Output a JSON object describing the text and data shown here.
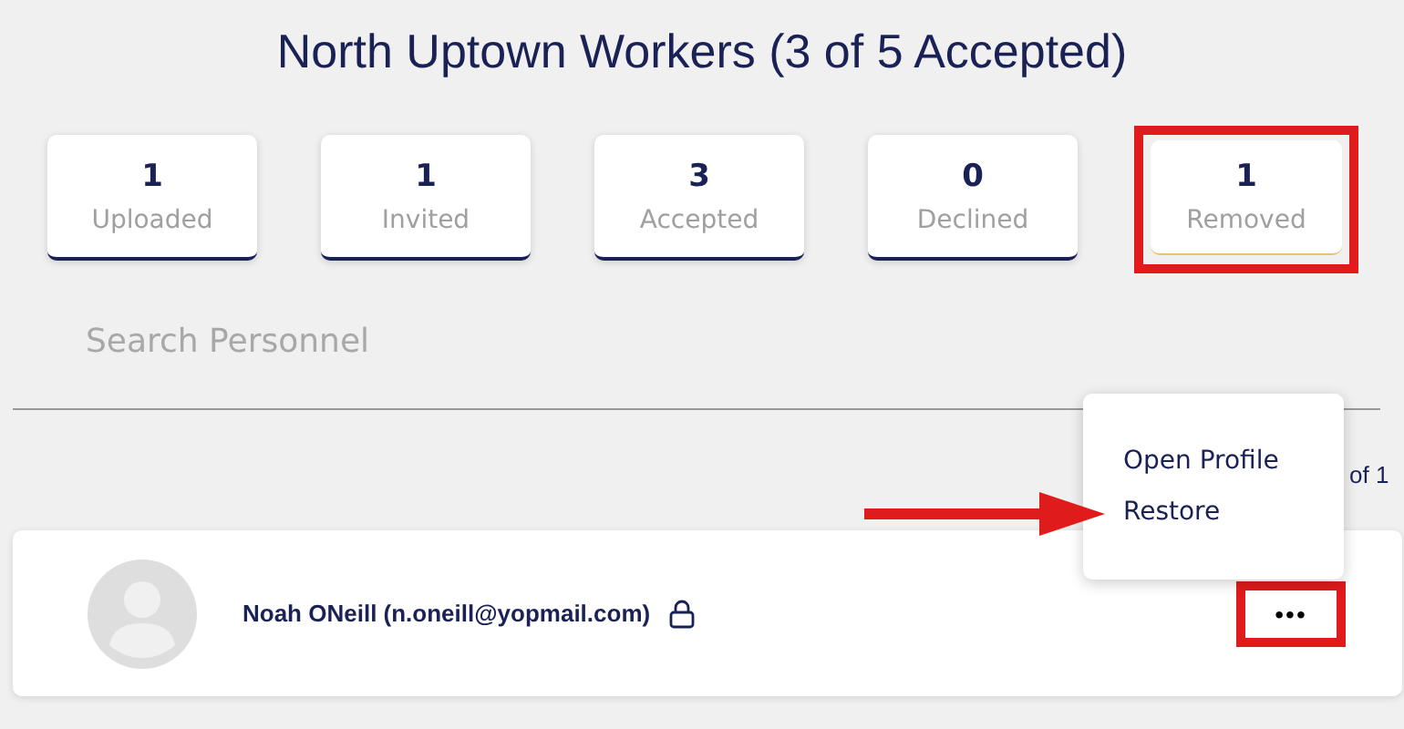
{
  "title": "North Uptown Workers (3 of 5 Accepted)",
  "stats": [
    {
      "count": "1",
      "label": "Uploaded",
      "highlighted": false
    },
    {
      "count": "1",
      "label": "Invited",
      "highlighted": false
    },
    {
      "count": "3",
      "label": "Accepted",
      "highlighted": false
    },
    {
      "count": "0",
      "label": "Declined",
      "highlighted": false
    },
    {
      "count": "1",
      "label": "Removed",
      "highlighted": true
    }
  ],
  "search": {
    "placeholder": "Search Personnel"
  },
  "pagination": "of 1",
  "menu": {
    "items": [
      "Open Profile",
      "Restore"
    ]
  },
  "person": {
    "name": "Noah ONeill (n.oneill@yopmail.com)",
    "locked": true,
    "more_button": {
      "label": "•••",
      "highlighted": true
    }
  }
}
